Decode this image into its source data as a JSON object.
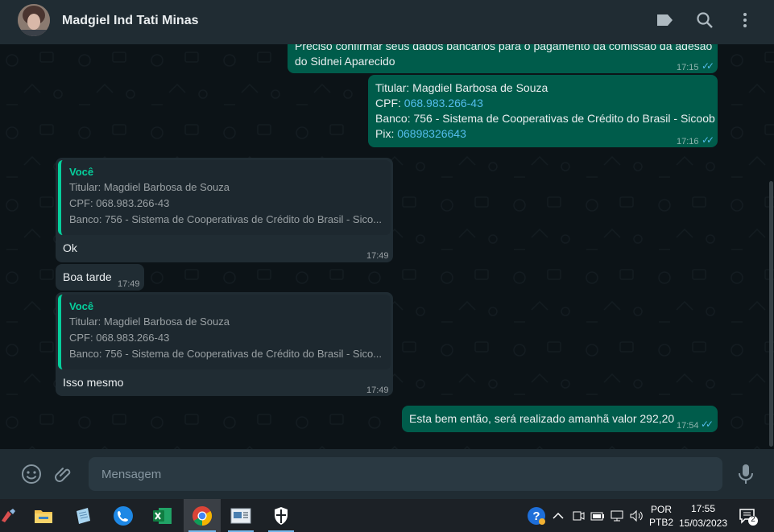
{
  "header": {
    "contact_name": "Madgiel Ind Tati Minas",
    "icons": [
      "label-icon",
      "search-icon",
      "menu-icon"
    ]
  },
  "messages": {
    "m1": {
      "text_line1": "Preciso confirmar seus dados bancarios para o pagamento da comissão da adesão",
      "text_line2": "do Sidnei Aparecido",
      "time": "17:15"
    },
    "m2": {
      "titular": "Titular: Magdiel Barbosa de Souza",
      "cpf_label": "CPF: ",
      "cpf_value": "068.983.266-43",
      "banco": "Banco: 756 - Sistema de Cooperativas de Crédito do Brasil - Sicoob",
      "pix_label": "Pix: ",
      "pix_value": "06898326643",
      "time": "17:16"
    },
    "m3": {
      "quote_author": "Você",
      "quote_lines": [
        "Titular: Magdiel Barbosa de Souza",
        "CPF: 068.983.266-43",
        "Banco: 756 - Sistema de Cooperativas de Crédito do Brasil - Sico..."
      ],
      "text": "Ok",
      "time": "17:49"
    },
    "m4": {
      "text": "Boa tarde",
      "time": "17:49"
    },
    "m5": {
      "quote_author": "Você",
      "quote_lines": [
        "Titular: Magdiel Barbosa de Souza",
        "CPF: 068.983.266-43",
        "Banco: 756 - Sistema de Cooperativas de Crédito do Brasil - Sico..."
      ],
      "text": "Isso mesmo",
      "time": "17:49"
    },
    "m6": {
      "text": "Esta bem então, será realizado amanhã valor 292,20",
      "time": "17:54"
    }
  },
  "composer": {
    "placeholder": "Mensagem"
  },
  "taskbar": {
    "apps": [
      "paint-icon",
      "file-explorer-icon",
      "notepad-icon",
      "phone-icon",
      "excel-icon",
      "chrome-icon",
      "app-window-icon",
      "security-icon"
    ],
    "lang_line1": "POR",
    "lang_line2": "PTB2",
    "clock_time": "17:55",
    "clock_date": "15/03/2023",
    "notification_count": "2"
  },
  "colors": {
    "header_bg": "#202c33",
    "chat_bg": "#0c1317",
    "outgoing_bubble": "#005c4b",
    "incoming_bubble": "#202c33",
    "accent": "#06cf9c",
    "link": "#53bdeb"
  }
}
